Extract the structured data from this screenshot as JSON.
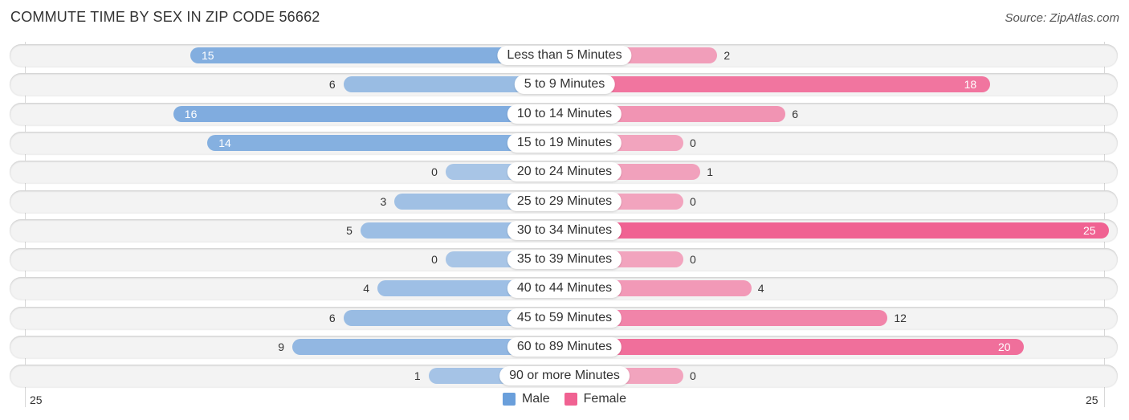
{
  "chart_data": {
    "type": "bar",
    "orientation": "horizontal-diverging",
    "title": "COMMUTE TIME BY SEX IN ZIP CODE 56662",
    "source": "Source: ZipAtlas.com",
    "categories": [
      "Less than 5 Minutes",
      "5 to 9 Minutes",
      "10 to 14 Minutes",
      "15 to 19 Minutes",
      "20 to 24 Minutes",
      "25 to 29 Minutes",
      "30 to 34 Minutes",
      "35 to 39 Minutes",
      "40 to 44 Minutes",
      "45 to 59 Minutes",
      "60 to 89 Minutes",
      "90 or more Minutes"
    ],
    "series": [
      {
        "name": "Male",
        "color": "#6a9fdb",
        "values": [
          15,
          6,
          16,
          14,
          0,
          3,
          5,
          0,
          4,
          6,
          9,
          1
        ]
      },
      {
        "name": "Female",
        "color": "#f06292",
        "values": [
          2,
          18,
          6,
          0,
          1,
          0,
          25,
          0,
          4,
          12,
          20,
          0
        ]
      }
    ],
    "axis": {
      "left_label": "25",
      "right_label": "25",
      "max": 25
    },
    "legend": {
      "position": "bottom-center",
      "items": [
        {
          "label": "Male",
          "color": "#6a9fdb"
        },
        {
          "label": "Female",
          "color": "#f06292"
        }
      ]
    }
  }
}
